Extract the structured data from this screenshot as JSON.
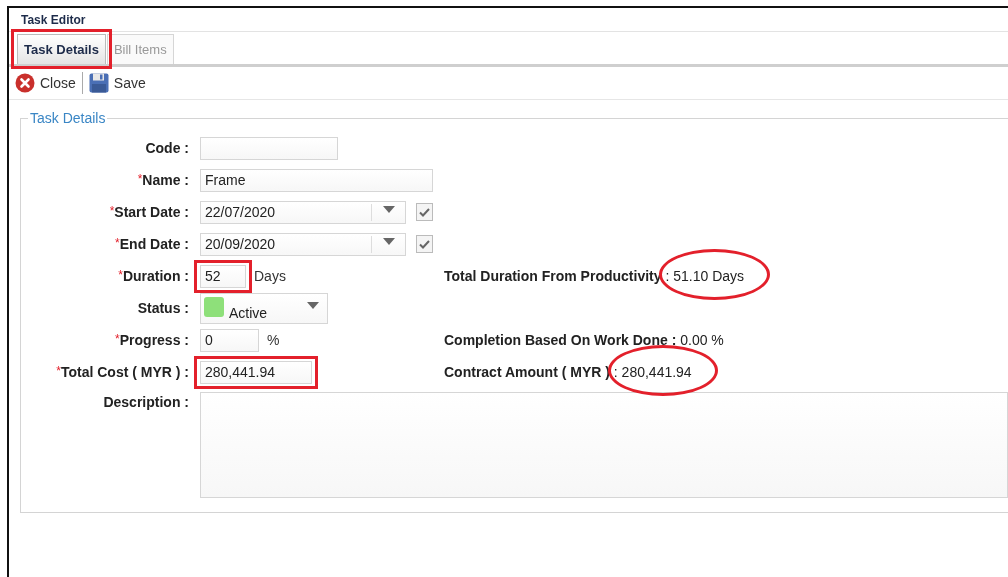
{
  "window": {
    "title": "Task Editor"
  },
  "tabs": [
    {
      "label": "Task Details",
      "selected": true,
      "boxed": true
    },
    {
      "label": "Bill Items",
      "selected": false
    }
  ],
  "toolbar": [
    {
      "kind": "close",
      "label": "Close"
    },
    {
      "kind": "save",
      "label": "Save"
    }
  ],
  "section": {
    "title": "Task Details"
  },
  "rows": [
    {
      "kind": "short_text",
      "label": "Code :"
    },
    {
      "kind": "long_text",
      "mark": "*",
      "label": "Name :",
      "value": "Frame"
    },
    {
      "kind": "date",
      "mark": "*",
      "label": "Start Date :",
      "value": "22/07/2020",
      "checked": true
    },
    {
      "kind": "date",
      "mark": "*",
      "label": "End Date :",
      "value": "20/09/2020",
      "checked": true
    },
    {
      "kind": "number",
      "mark": "*",
      "label": "Duration :",
      "value": "52",
      "unit": "Days",
      "boxed": true,
      "info": {
        "label": "Total Duration From Productivity",
        "value": ": 51.10 Days",
        "circled": true
      }
    },
    {
      "kind": "status",
      "label": "Status :",
      "value": "Active",
      "color": "#8ee07a"
    },
    {
      "kind": "percent",
      "mark": "*",
      "label": "Progress :",
      "value": "0",
      "unit": "%",
      "info": {
        "label": "Completion Based On Work Done :",
        "value": "0.00 %"
      }
    },
    {
      "kind": "money",
      "mark": "*",
      "label": "Total Cost ( MYR ) :",
      "value": "280,441.94",
      "boxed": true,
      "info": {
        "label": "Contract Amount ( MYR )",
        "value": ": 280,441.94",
        "circled": true
      }
    },
    {
      "kind": "textarea",
      "label": "Description :"
    }
  ]
}
